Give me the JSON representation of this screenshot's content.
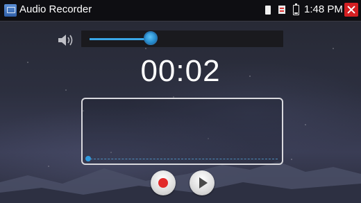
{
  "titlebar": {
    "app_icon": "tv-app-icon",
    "title": "Audio Recorder",
    "status_icons": [
      "sd-card-icon",
      "usb-icon",
      "battery-icon"
    ],
    "time": "1:48 PM",
    "close_icon": "close-icon",
    "close_color": "#d41f22"
  },
  "volume": {
    "icon": "speaker-icon",
    "level": 0.33,
    "accent_color": "#3aa6e6"
  },
  "timer": {
    "elapsed": "00:02"
  },
  "waveform": {
    "progress": 0.0,
    "accent_color": "#2f9be0"
  },
  "controls": {
    "record_icon": "record-icon",
    "record_color": "#e22a2a",
    "play_icon": "play-icon"
  }
}
